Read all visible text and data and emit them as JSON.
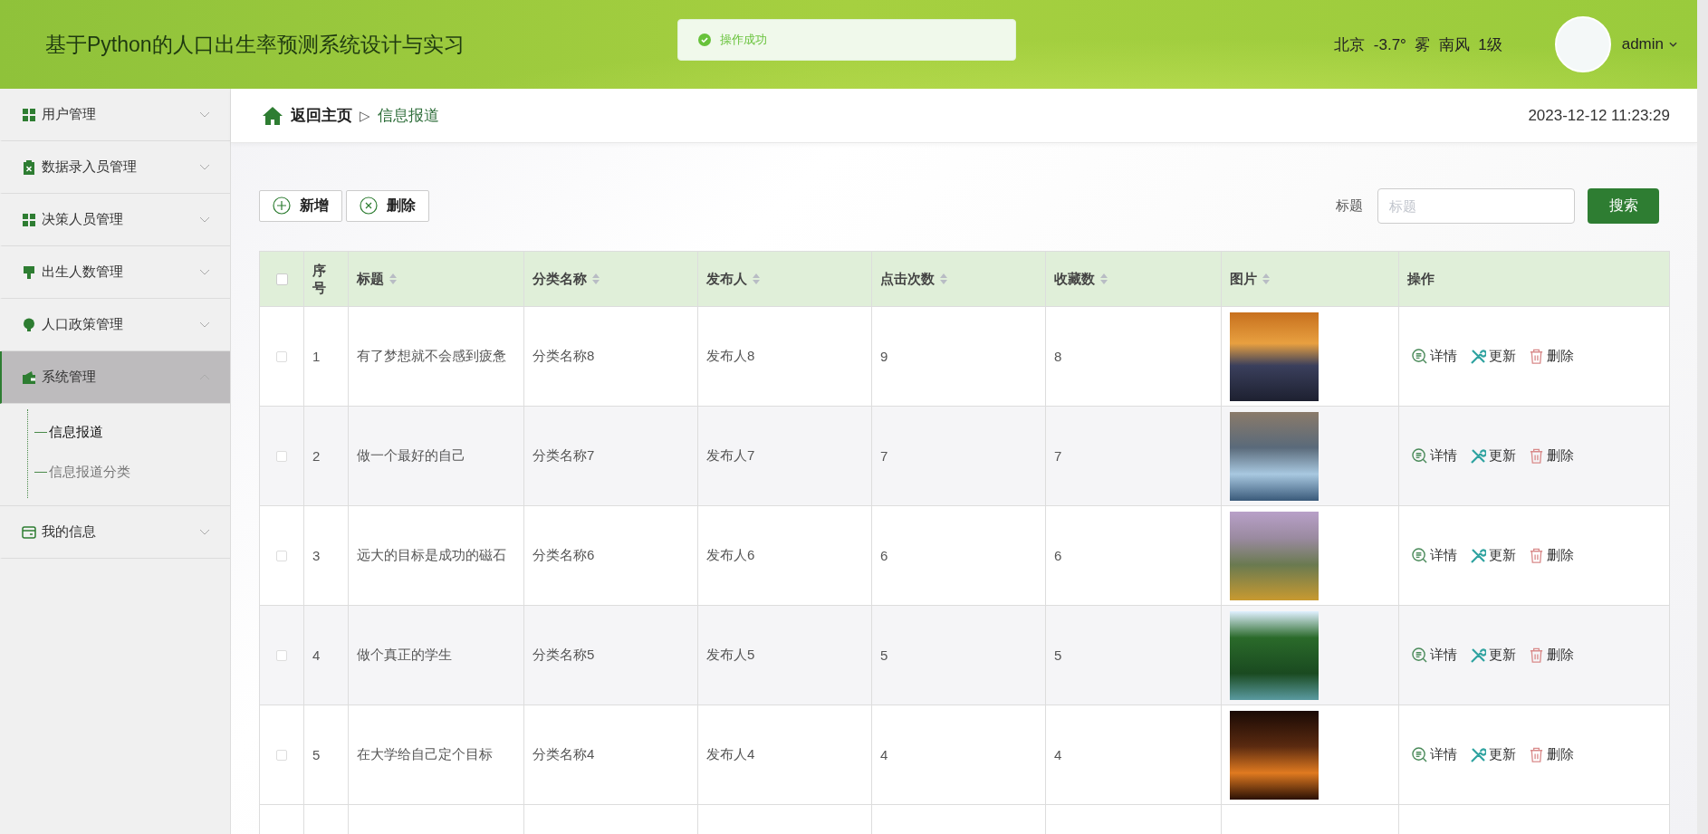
{
  "header": {
    "title": "基于Python的人口出生率预测系统设计与实习",
    "weather": "北京  -3.7°  雾  南风  1级",
    "user": "admin"
  },
  "toast": {
    "message": "操作成功"
  },
  "sidebar": {
    "items": [
      {
        "label": "用户管理",
        "expanded": false,
        "selected": false
      },
      {
        "label": "数据录入员管理",
        "expanded": false,
        "selected": false
      },
      {
        "label": "决策人员管理",
        "expanded": false,
        "selected": false
      },
      {
        "label": "出生人数管理",
        "expanded": false,
        "selected": false
      },
      {
        "label": "人口政策管理",
        "expanded": false,
        "selected": false
      },
      {
        "label": "系统管理",
        "expanded": true,
        "selected": true,
        "children": [
          {
            "label": "信息报道",
            "selected": true
          },
          {
            "label": "信息报道分类",
            "selected": false
          }
        ]
      },
      {
        "label": "我的信息",
        "expanded": false,
        "selected": false
      }
    ]
  },
  "breadcrumb": {
    "home": "返回主页",
    "separator": "▷",
    "current": "信息报道",
    "datetime": "2023-12-12 11:23:29"
  },
  "toolbar": {
    "buttons": [
      {
        "label": "新增",
        "kind": "add"
      },
      {
        "label": "删除",
        "kind": "delete"
      }
    ],
    "search_label": "标题",
    "search_placeholder": "标题",
    "search_button": "搜索"
  },
  "table": {
    "header_checked": false,
    "columns": [
      {
        "label": "序号",
        "sortable": false
      },
      {
        "label": "标题",
        "sortable": true
      },
      {
        "label": "分类名称",
        "sortable": true
      },
      {
        "label": "发布人",
        "sortable": true
      },
      {
        "label": "点击次数",
        "sortable": true
      },
      {
        "label": "收藏数",
        "sortable": true
      },
      {
        "label": "图片",
        "sortable": true
      },
      {
        "label": "操作",
        "sortable": false
      }
    ],
    "rows": [
      {
        "checked": false,
        "index": "1",
        "title": "有了梦想就不会感到疲惫",
        "category": "分类名称8",
        "publisher": "发布人8",
        "clicks": "9",
        "favorites": "8",
        "actions": [
          {
            "label": "详情",
            "kind": "detail"
          },
          {
            "label": "更新",
            "kind": "update"
          },
          {
            "label": "删除",
            "kind": "delete"
          }
        ]
      },
      {
        "checked": false,
        "index": "2",
        "title": "做一个最好的自己",
        "category": "分类名称7",
        "publisher": "发布人7",
        "clicks": "7",
        "favorites": "7",
        "actions": [
          {
            "label": "详情",
            "kind": "detail"
          },
          {
            "label": "更新",
            "kind": "update"
          },
          {
            "label": "删除",
            "kind": "delete"
          }
        ]
      },
      {
        "checked": false,
        "index": "3",
        "title": "远大的目标是成功的磁石",
        "category": "分类名称6",
        "publisher": "发布人6",
        "clicks": "6",
        "favorites": "6",
        "actions": [
          {
            "label": "详情",
            "kind": "detail"
          },
          {
            "label": "更新",
            "kind": "update"
          },
          {
            "label": "删除",
            "kind": "delete"
          }
        ]
      },
      {
        "checked": false,
        "index": "4",
        "title": "做个真正的学生",
        "category": "分类名称5",
        "publisher": "发布人5",
        "clicks": "5",
        "favorites": "5",
        "actions": [
          {
            "label": "详情",
            "kind": "detail"
          },
          {
            "label": "更新",
            "kind": "update"
          },
          {
            "label": "删除",
            "kind": "delete"
          }
        ]
      },
      {
        "checked": false,
        "index": "5",
        "title": "在大学给自己定个目标",
        "category": "分类名称4",
        "publisher": "发布人4",
        "clicks": "4",
        "favorites": "4",
        "actions": [
          {
            "label": "详情",
            "kind": "detail"
          },
          {
            "label": "更新",
            "kind": "update"
          },
          {
            "label": "删除",
            "kind": "delete"
          }
        ]
      }
    ]
  }
}
